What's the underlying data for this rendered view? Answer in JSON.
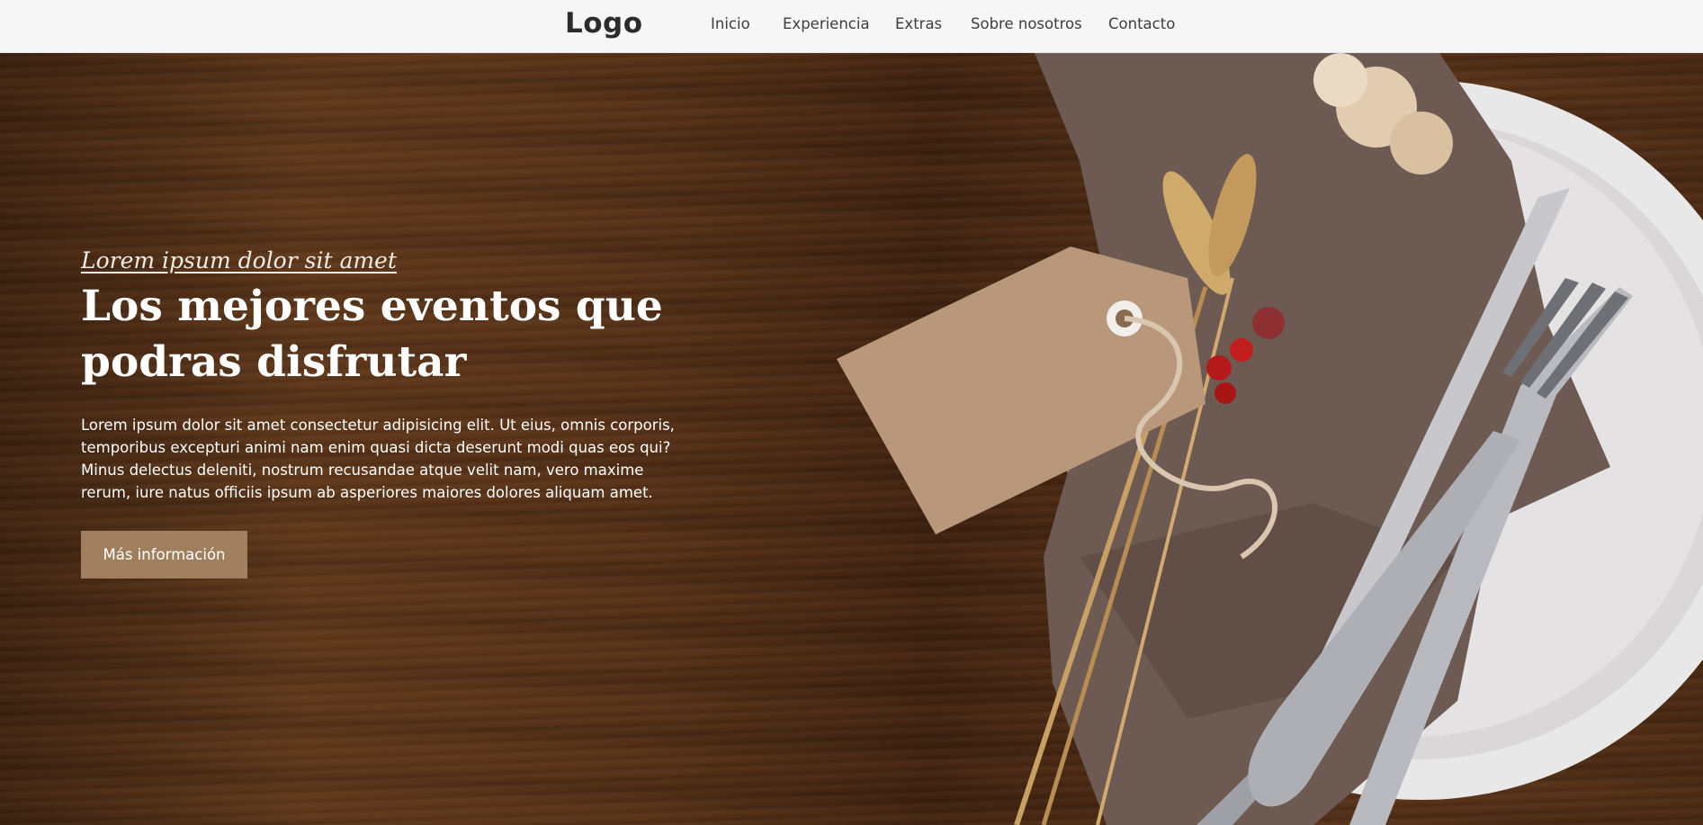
{
  "navbar": {
    "logo": "Logo",
    "links": [
      "Inicio",
      "Experiencia",
      "Extras",
      "Sobre nosotros",
      "Contacto"
    ]
  },
  "hero": {
    "eyebrow": "Lorem ipsum dolor sit amet",
    "title": "Los mejores eventos que podras disfrutar",
    "body": "Lorem ipsum dolor sit amet consectetur adipisicing elit. Ut eius, omnis corporis, temporibus excepturi animi nam enim quasi dicta deserunt modi quas eos qui? Minus delectus deleniti, nostrum recusandae atque velit nam, vero maxime rerum, iure natus officiis ipsum ab asperiores maiores dolores aliquam amet.",
    "button": "Más información"
  },
  "colors": {
    "navbar_bg": "#f6f6f6",
    "button_bg": "#a07f5f",
    "wood": "#5a3318"
  }
}
